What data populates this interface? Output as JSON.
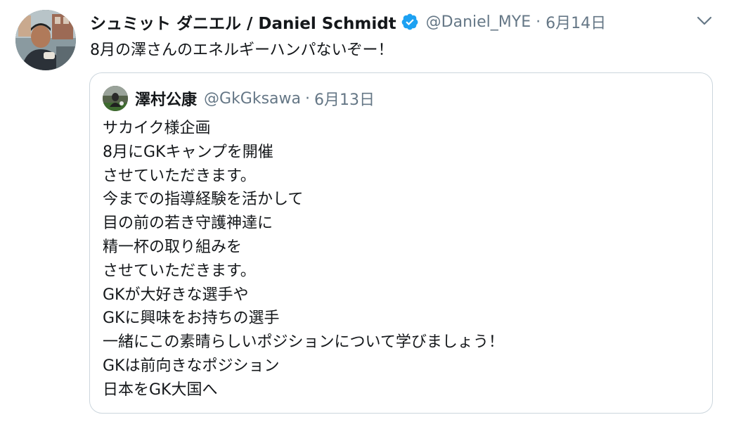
{
  "tweet": {
    "display_name": "シュミット ダニエル / Daniel Schmidt",
    "handle": "@Daniel_MYE",
    "separator": "·",
    "date": "6月14日",
    "text": "8月の澤さんのエネルギーハンパないぞー！",
    "avatar_icon": "user-avatar-photo",
    "verified_icon": "verified-badge-icon",
    "menu_icon": "chevron-down-icon",
    "colors": {
      "text": "#14171a",
      "secondary": "#657786",
      "verified": "#1da1f2",
      "border": "#ccd6dd"
    }
  },
  "quoted_tweet": {
    "display_name": "澤村公康",
    "handle": "@GkGksawa",
    "separator": "·",
    "date": "6月13日",
    "avatar_icon": "user-avatar-photo",
    "lines": [
      "サカイク様企画",
      "8月にGKキャンプを開催",
      "させていただきます。",
      "今までの指導経験を活かして",
      "目の前の若き守護神達に",
      "精一杯の取り組みを",
      "させていただきます。",
      "GKが大好きな選手や",
      "GKに興味をお持ちの選手",
      "一緒にこの素晴らしいポジションについて学びましょう！",
      "GKは前向きなポジション",
      "日本をGK大国へ"
    ]
  }
}
